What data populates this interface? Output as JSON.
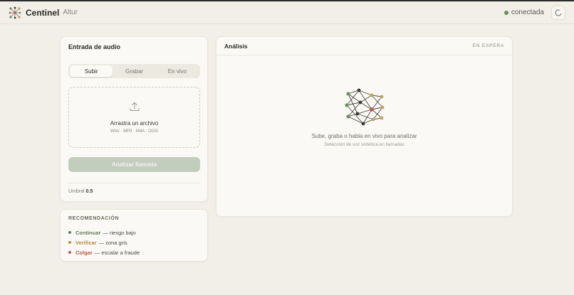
{
  "app": {
    "brand": "Centinel",
    "brand_sub": "Altur",
    "status": "conectada"
  },
  "input_card": {
    "title": "Entrada de audio",
    "tabs": [
      "Subir",
      "Grabar",
      "En vivo"
    ],
    "active_tab": "Subir",
    "dropzone": {
      "title": "Arrastra un archivo",
      "formats": "WAV · MP3 · M4A · OGG"
    },
    "analyze_label": "Analizar llamada",
    "threshold_label": "Umbral",
    "threshold_value": "0.5"
  },
  "recommendation": {
    "title": "RECOMENDACIÓN",
    "items": [
      {
        "label": "Continuar",
        "desc": "— riesgo bajo",
        "color": "#5f7f52"
      },
      {
        "label": "Verificar",
        "desc": "— zona gris",
        "color": "#b78a3c"
      },
      {
        "label": "Colgar",
        "desc": "— escalar a fraude",
        "color": "#b25c52"
      }
    ]
  },
  "analysis": {
    "title": "Análisis",
    "status": "EN ESPERA",
    "empty_title": "Sube, graba o habla en vivo para analizar",
    "empty_subtitle": "Detección de voz sintética en llamadas"
  },
  "colors": {
    "accent_green": "#6b8f5e",
    "accent_gold": "#c9a055",
    "accent_red": "#b25c52",
    "node_dark": "#3a3a36"
  }
}
